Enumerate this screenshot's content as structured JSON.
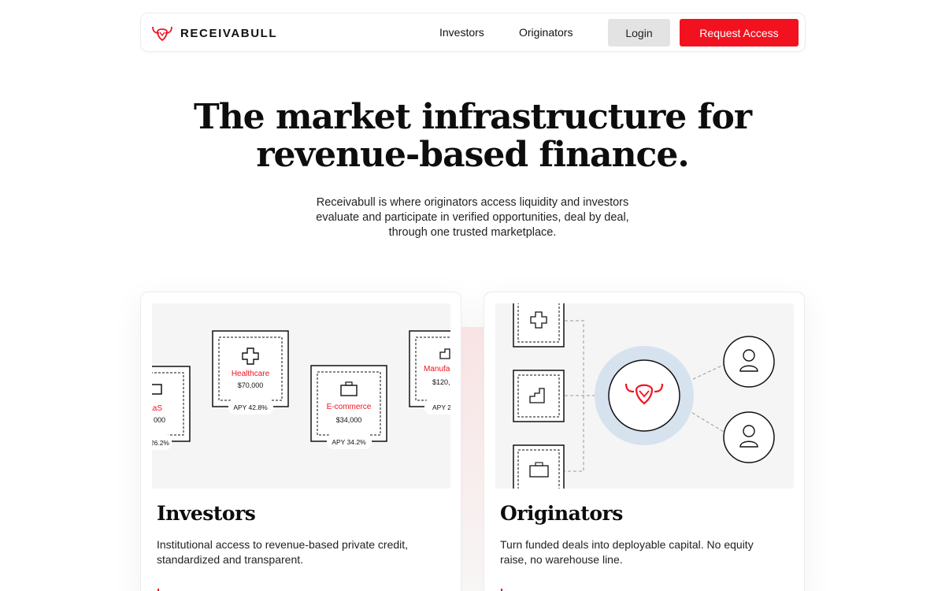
{
  "colors": {
    "accent": "#f2121f",
    "login_bg": "#e3e3e3",
    "figure_bg": "#f5f5f5",
    "glow": "#d7e2ef"
  },
  "nav": {
    "brand": "RECEIVABULL",
    "brand_icon": "bull-logo-icon",
    "links": [
      "Investors",
      "Originators"
    ],
    "login": "Login",
    "request": "Request Access"
  },
  "hero": {
    "title_lines": [
      "The market infrastructure for",
      "revenue-based finance."
    ],
    "subtitle_lines": [
      "Receivabull is where originators access liquidity and investors",
      "evaluate and participate in verified opportunities, deal by deal,",
      "through one trusted marketplace."
    ]
  },
  "cards": [
    {
      "title": "Investors",
      "desc_lines": [
        "Institutional access to revenue-based private credit,",
        "standardized and transparent."
      ],
      "figure": {
        "deals": [
          {
            "sector": "aaS",
            "amount": "000",
            "apy": "26.2%",
            "icon": "monitor-icon"
          },
          {
            "sector": "Healthcare",
            "amount": "$70,000",
            "apy": "APY 42.8%",
            "icon": "medical-cross-icon"
          },
          {
            "sector": "E-commerce",
            "amount": "$34,000",
            "apy": "APY 34.2%",
            "icon": "briefcase-icon"
          },
          {
            "sector": "Manufac",
            "amount": "$120,",
            "apy": "APY 2",
            "icon": "factory-icon"
          }
        ]
      }
    },
    {
      "title": "Originators",
      "desc_lines": [
        "Turn funded deals into deployable capital. No equity",
        "raise, no warehouse line."
      ],
      "figure": {
        "left_icons": [
          "medical-cross-icon",
          "factory-icon",
          "briefcase-icon"
        ],
        "center_icon": "bull-logo-icon",
        "right_icons": [
          "user-icon",
          "user-icon"
        ]
      }
    }
  ]
}
